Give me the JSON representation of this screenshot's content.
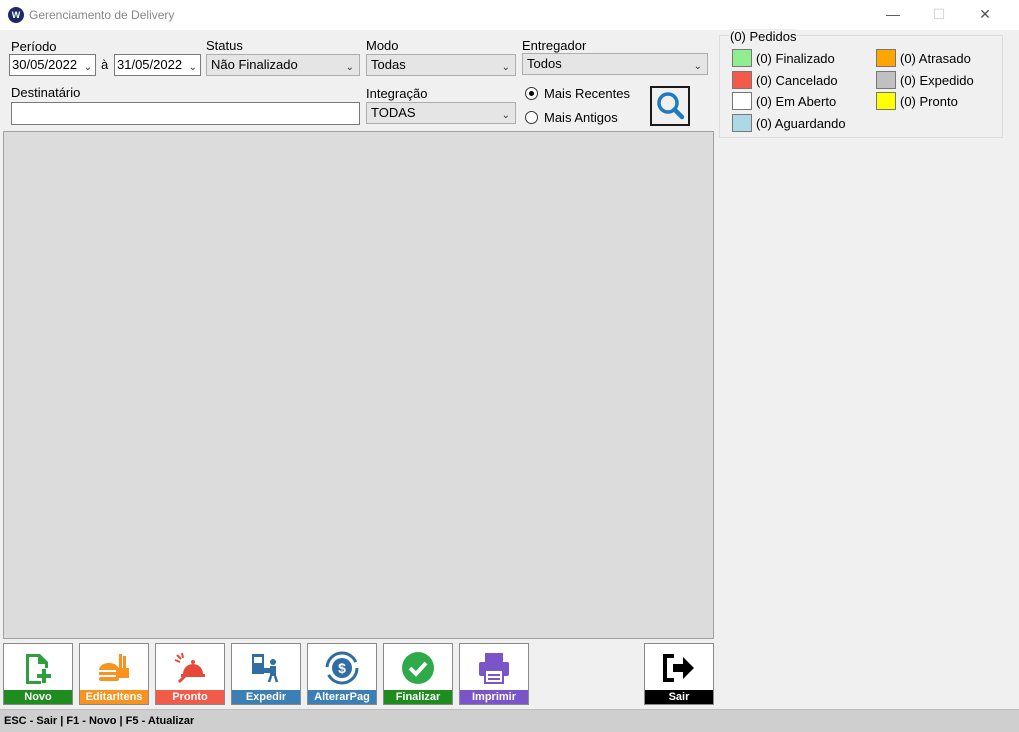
{
  "window": {
    "title": "Gerenciamento de Delivery",
    "icon_text": "W"
  },
  "filters": {
    "periodo_label": "Período",
    "date_from": "30/05/2022",
    "date_sep": "à",
    "date_to": "31/05/2022",
    "status_label": "Status",
    "status_value": "Não Finalizado",
    "modo_label": "Modo",
    "modo_value": "Todas",
    "entregador_label": "Entregador",
    "entregador_value": "Todos",
    "destinatario_label": "Destinatário",
    "destinatario_value": "",
    "integracao_label": "Integração",
    "integracao_value": "TODAS",
    "order_recent": "Mais Recentes",
    "order_old": "Mais Antigos",
    "order_selected": "Mais Recentes"
  },
  "legend": {
    "title": "(0) Pedidos",
    "items": [
      {
        "label": "(0) Finalizado",
        "color": "#90ee90"
      },
      {
        "label": "(0) Atrasado",
        "color": "#ffa500"
      },
      {
        "label": "(0) Cancelado",
        "color": "#f25b4a"
      },
      {
        "label": "(0) Expedido",
        "color": "#c0c0c0"
      },
      {
        "label": "(0) Em Aberto",
        "color": "#ffffff"
      },
      {
        "label": "(0) Pronto",
        "color": "#ffff00"
      },
      {
        "label": "(0) Aguardando",
        "color": "#add8e6"
      }
    ]
  },
  "toolbar": {
    "buttons": [
      {
        "label": "Novo",
        "color": "#1e8c1e",
        "icon": "add-document-icon"
      },
      {
        "label": "EditarItens",
        "color": "#f7931e",
        "icon": "food-icon"
      },
      {
        "label": "Pronto",
        "color": "#f25b4a",
        "icon": "chef-bell-icon"
      },
      {
        "label": "Expedir",
        "color": "#3b7fb5",
        "icon": "delivery-person-icon"
      },
      {
        "label": "AlterarPag",
        "color": "#3b7fb5",
        "icon": "payment-cycle-icon"
      },
      {
        "label": "Finalizar",
        "color": "#1e8c1e",
        "icon": "check-circle-icon"
      },
      {
        "label": "Imprimir",
        "color": "#7a55c8",
        "icon": "printer-icon"
      },
      {
        "label": "Sair",
        "color": "#000000",
        "icon": "exit-arrow-icon"
      }
    ]
  },
  "statusbar": {
    "text": "ESC - Sair | F1 - Novo | F5 - Atualizar"
  }
}
